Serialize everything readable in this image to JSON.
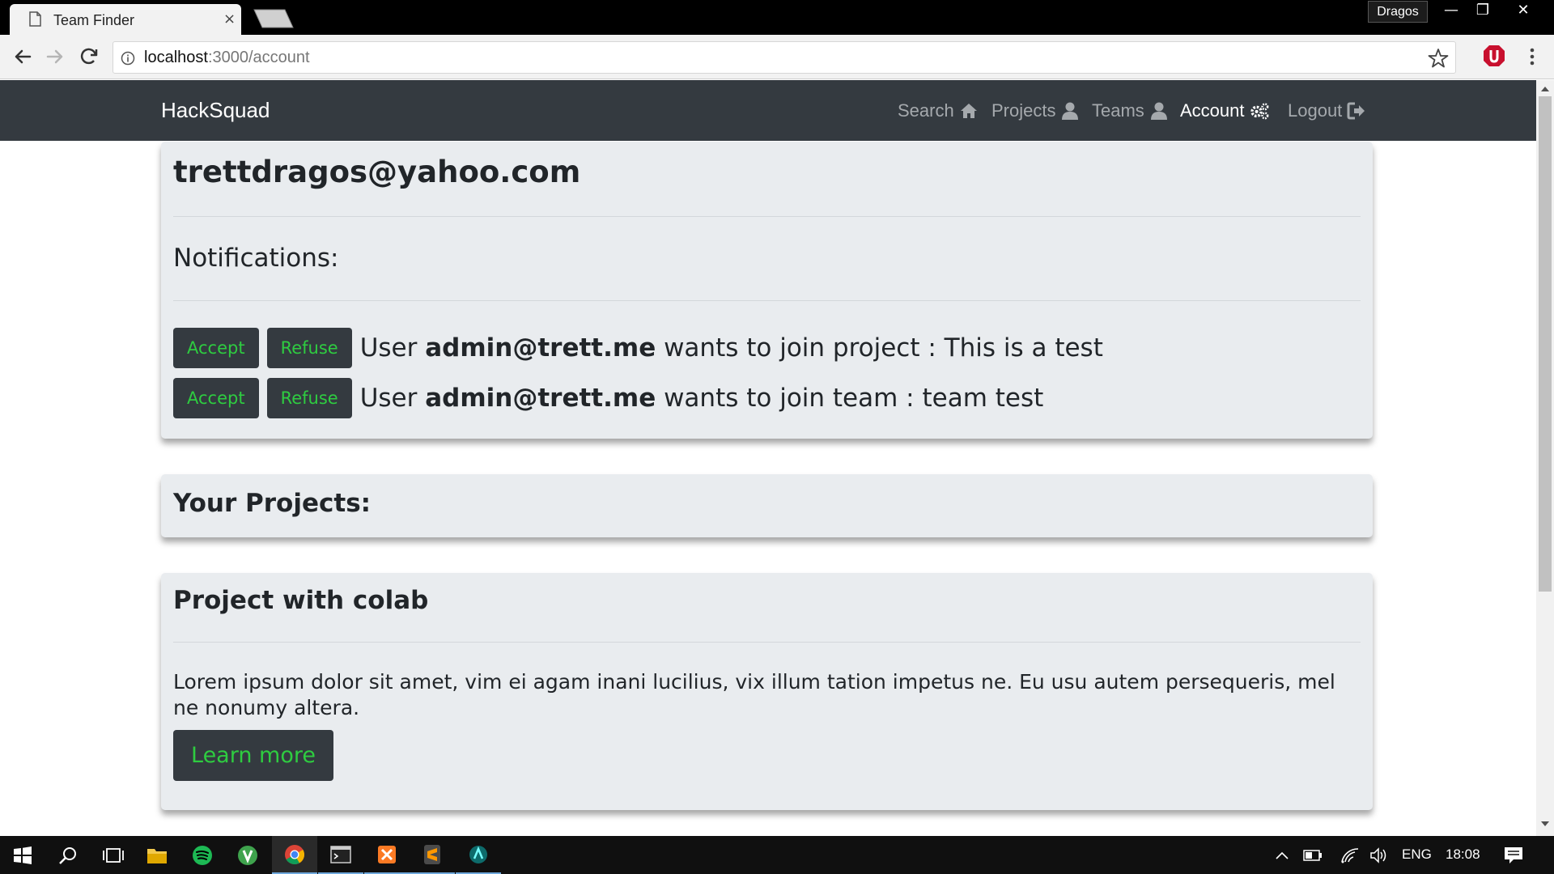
{
  "browser": {
    "tab_title": "Team Finder",
    "tab_close": "×",
    "profile_name": "Dragos",
    "window_controls": {
      "minimize": "—",
      "restore": "❐",
      "close": "✕"
    },
    "url_host": "localhost",
    "url_path": ":3000/account",
    "icons": [
      "back-icon",
      "forward-icon",
      "reload-icon",
      "info-icon",
      "bookmark-star-icon",
      "extension-icon",
      "menu-icon"
    ]
  },
  "navbar": {
    "brand": "HackSquad",
    "links": [
      {
        "label": "Search",
        "icon": "home-icon"
      },
      {
        "label": "Projects",
        "icon": "user-icon"
      },
      {
        "label": "Teams",
        "icon": "user-icon"
      },
      {
        "label": "Account",
        "icon": "gears-icon",
        "active": true
      },
      {
        "label": "Logout",
        "icon": "sign-out-icon"
      }
    ]
  },
  "account": {
    "email": "trettdragos@yahoo.com",
    "notifications_heading": "Notifications:",
    "notifications": [
      {
        "accept": "Accept",
        "refuse": "Refuse",
        "prefix": "User ",
        "user": "admin@trett.me",
        "suffix": " wants to join project : This is a test"
      },
      {
        "accept": "Accept",
        "refuse": "Refuse",
        "prefix": "User ",
        "user": "admin@trett.me",
        "suffix": " wants to join team : team test"
      }
    ]
  },
  "projects": {
    "heading": "Your Projects:",
    "items": [
      {
        "title": "Project with colab",
        "description": "Lorem ipsum dolor sit amet, vim ei agam inani lucilius, vix illum tation impetus ne. Eu usu autem persequeris, mel ne nonumy altera.",
        "button": "Learn more"
      }
    ]
  },
  "taskbar": {
    "apps": [
      "windows-start-icon",
      "search-icon",
      "task-view-icon",
      "file-explorer-icon",
      "spotify-icon",
      "app-icon",
      "chrome-icon",
      "terminal-icon",
      "xampp-icon",
      "sublime-icon",
      "app-icon"
    ],
    "language": "ENG",
    "time": "18:08"
  },
  "colors": {
    "navbar_bg": "#343a40",
    "card_bg": "#e9ecef",
    "button_text": "#2ecc40"
  }
}
